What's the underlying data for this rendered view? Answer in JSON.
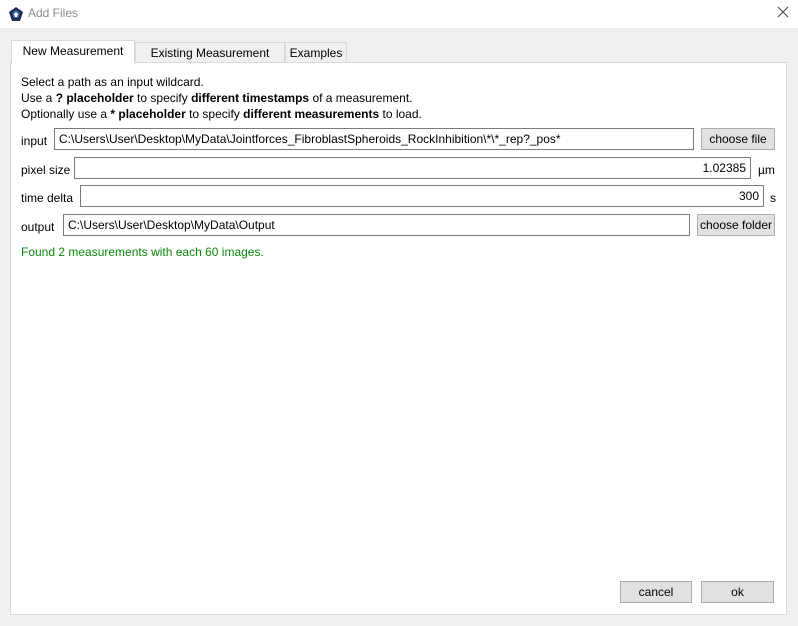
{
  "window": {
    "title": "Add Files",
    "icon": "app-logo-icon",
    "close_icon": "close-icon"
  },
  "tabs": [
    {
      "label": "New Measurement",
      "active": true
    },
    {
      "label": "Existing Measurement",
      "active": false
    },
    {
      "label": "Examples",
      "active": false
    }
  ],
  "instructions": {
    "line1": "Select a path as an input wildcard.",
    "line2_a": "Use a ",
    "line2_b": "? placeholder",
    "line2_c": " to specify ",
    "line2_d": "different timestamps",
    "line2_e": " of a measurement.",
    "line3_a": "Optionally use a ",
    "line3_b": "* placeholder",
    "line3_c": " to specify ",
    "line3_d": "different measurements",
    "line3_e": " to load."
  },
  "form": {
    "input_label": "input",
    "input_value": "C:\\Users\\User\\Desktop\\MyData\\Jointforces_FibroblastSpheroids_RockInhibition\\*\\*_rep?_pos*",
    "choose_file_label": "choose file",
    "pixel_size_label": "pixel size",
    "pixel_size_value": "1.02385",
    "pixel_size_unit": "µm",
    "time_delta_label": "time delta",
    "time_delta_value": "300",
    "time_delta_unit": "s",
    "output_label": "output",
    "output_value": "C:\\Users\\User\\Desktop\\MyData\\Output",
    "choose_folder_label": "choose folder"
  },
  "status": {
    "text": "Found 2 measurements with each 60 images.",
    "color": "#0a8a0a"
  },
  "buttons": {
    "cancel_label": "cancel",
    "ok_label": "ok"
  }
}
